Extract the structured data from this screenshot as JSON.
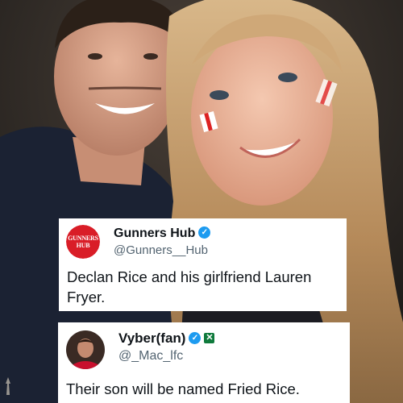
{
  "photo": {
    "description_icon": "selfie-photo"
  },
  "tweets": [
    {
      "display_name": "Gunners Hub",
      "handle": "@Gunners__Hub",
      "avatar_text_line1": "GUNNERS",
      "avatar_text_line2": "HUB",
      "verified": true,
      "text": "Declan Rice and his girlfriend Lauren Fryer."
    },
    {
      "display_name": "Vyber(fan)",
      "handle": "@_Mac_lfc",
      "verified": true,
      "extra_badge_icon": "green-x-badge-icon",
      "text": "Their son will be named Fried Rice."
    }
  ],
  "colors": {
    "verified": "#1d9bf0",
    "gunners_red": "#d91d27",
    "text": "#0f1419",
    "muted": "#536471"
  }
}
